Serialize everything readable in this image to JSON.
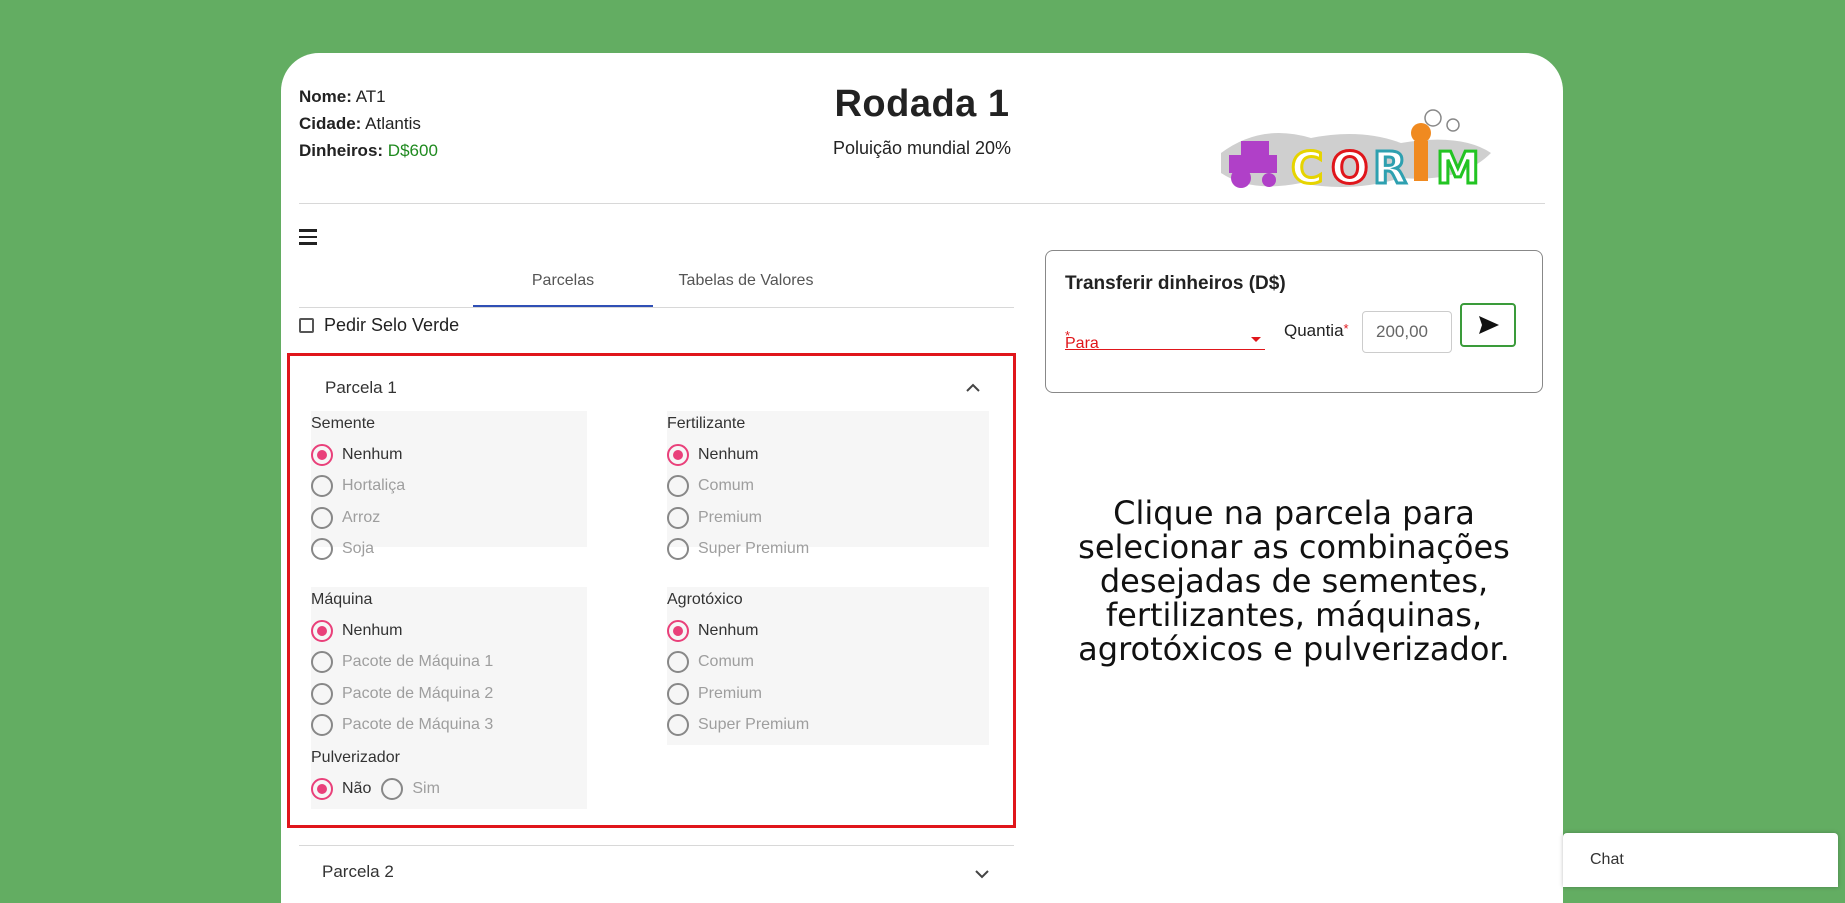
{
  "player": {
    "name_label": "Nome:",
    "name": "AT1",
    "city_label": "Cidade:",
    "city": "Atlantis",
    "money_label": "Dinheiros:",
    "money": "D$600"
  },
  "header": {
    "title": "Rodada 1",
    "pollution": "Poluição mundial 20%",
    "logo_text": "CORIM"
  },
  "tabs": [
    {
      "label": "Parcelas",
      "active": true
    },
    {
      "label": "Tabelas de Valores",
      "active": false
    }
  ],
  "selo_label": "Pedir Selo Verde",
  "parcela1": {
    "title": "Parcela 1",
    "semente": {
      "label": "Semente",
      "options": [
        "Nenhum",
        "Hortaliça",
        "Arroz",
        "Soja"
      ],
      "selected": "Nenhum"
    },
    "fertilizante": {
      "label": "Fertilizante",
      "options": [
        "Nenhum",
        "Comum",
        "Premium",
        "Super Premium"
      ],
      "selected": "Nenhum"
    },
    "maquina": {
      "label": "Máquina",
      "options": [
        "Nenhum",
        "Pacote de Máquina 1",
        "Pacote de Máquina 2",
        "Pacote de Máquina 3"
      ],
      "selected": "Nenhum"
    },
    "agrotoxico": {
      "label": "Agrotóxico",
      "options": [
        "Nenhum",
        "Comum",
        "Premium",
        "Super Premium"
      ],
      "selected": "Nenhum"
    },
    "pulverizador": {
      "label": "Pulverizador",
      "options": [
        "Não",
        "Sim"
      ],
      "selected": "Não"
    }
  },
  "parcela2": {
    "title": "Parcela 2"
  },
  "transfer": {
    "title": "Transferir dinheiros (D$)",
    "para_label": "Para",
    "required_mark": "*",
    "quantia_label": "Quantia",
    "quantia_value": "200,00"
  },
  "instructions": "Clique na parcela para selecionar as combinações desejadas de sementes, fertilizantes, máquinas, agrotóxicos e pulverizador.",
  "chat_label": "Chat",
  "colors": {
    "background": "#63ad62",
    "accent_pink": "#e9407a",
    "highlight_red": "#e0161b",
    "tab_underline": "#2f4fb5",
    "money_green": "#1f8a1f"
  }
}
